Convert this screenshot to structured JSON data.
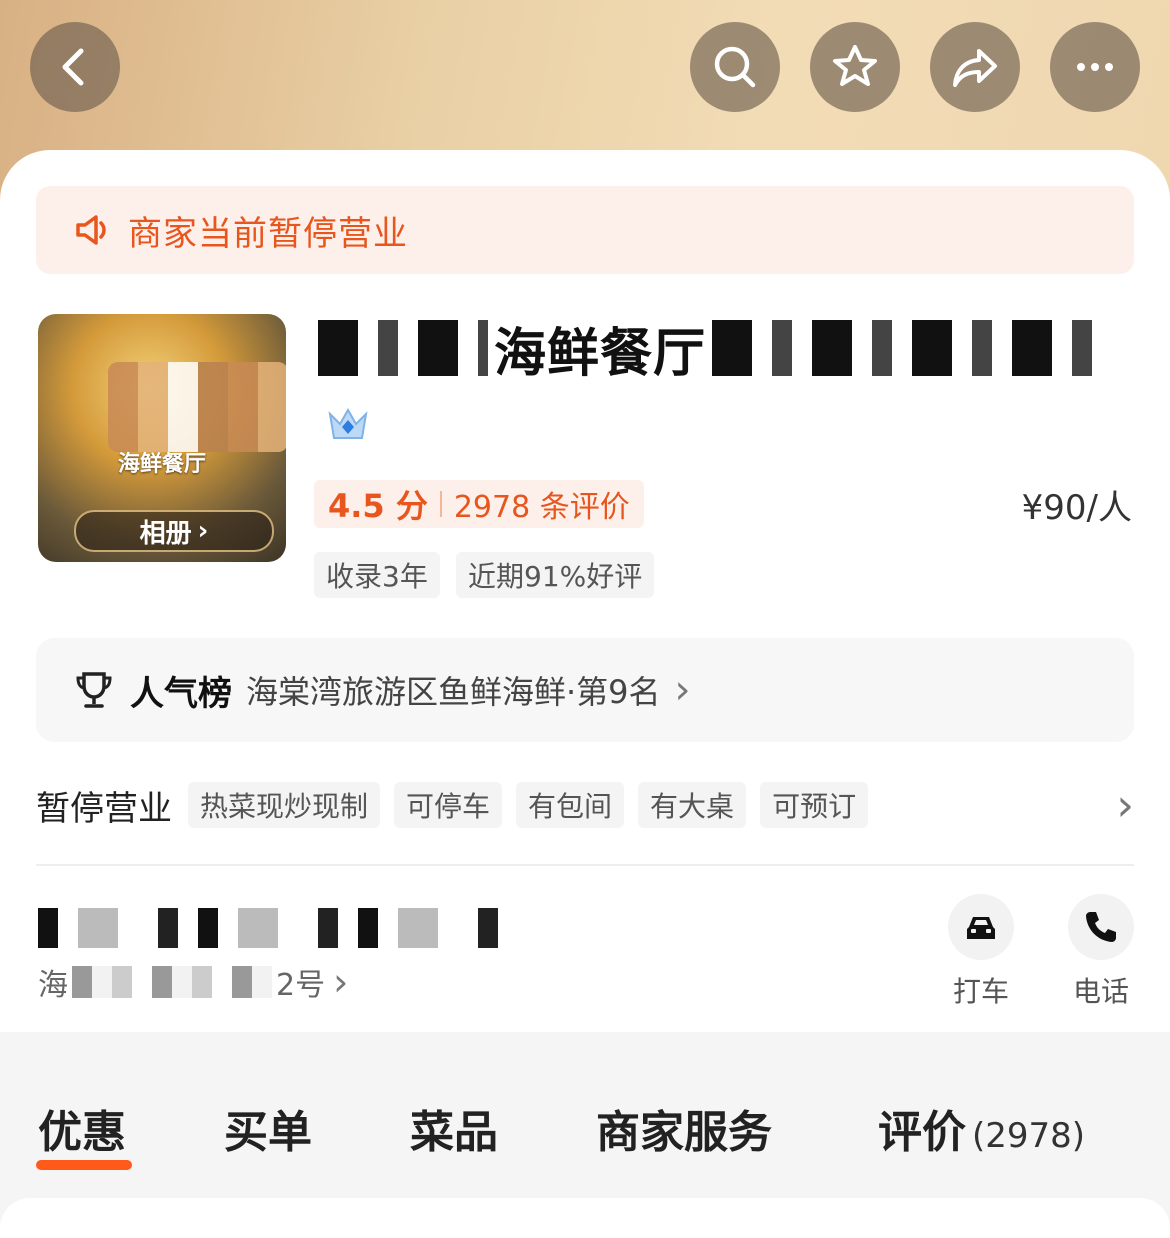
{
  "nav": {
    "back_icon": "chevron-left-icon",
    "search_icon": "search-icon",
    "favorite_icon": "star-icon",
    "share_icon": "share-icon",
    "more_icon": "more-icon"
  },
  "notice": {
    "icon": "megaphone-icon",
    "text": "商家当前暂停营业"
  },
  "shop": {
    "thumb_title": "海鲜餐厅",
    "album_label": "相册",
    "name": "海鲜餐厅",
    "badge_icon": "crown-icon",
    "rating": "4.5 分",
    "reviews": "2978 条评价",
    "price": "¥90/人",
    "tags": [
      "收录3年",
      "近期91%好评"
    ]
  },
  "ranking": {
    "icon": "trophy-icon",
    "label": "人气榜",
    "text": "海棠湾旅游区鱼鲜海鲜·第9名"
  },
  "status": {
    "label": "暂停营业",
    "features": [
      "热菜现炒现制",
      "可停车",
      "有包间",
      "有大桌",
      "可预订"
    ]
  },
  "address": {
    "prefix": "海",
    "suffix": "2号"
  },
  "actions": {
    "taxi_label": "打车",
    "phone_label": "电话"
  },
  "tabs": [
    {
      "label": "优惠"
    },
    {
      "label": "买单"
    },
    {
      "label": "菜品"
    },
    {
      "label": "商家服务"
    },
    {
      "label": "评价",
      "count": "(2978)"
    }
  ],
  "colors": {
    "accent": "#e8561e",
    "tab_underline": "#ff5a1a"
  }
}
